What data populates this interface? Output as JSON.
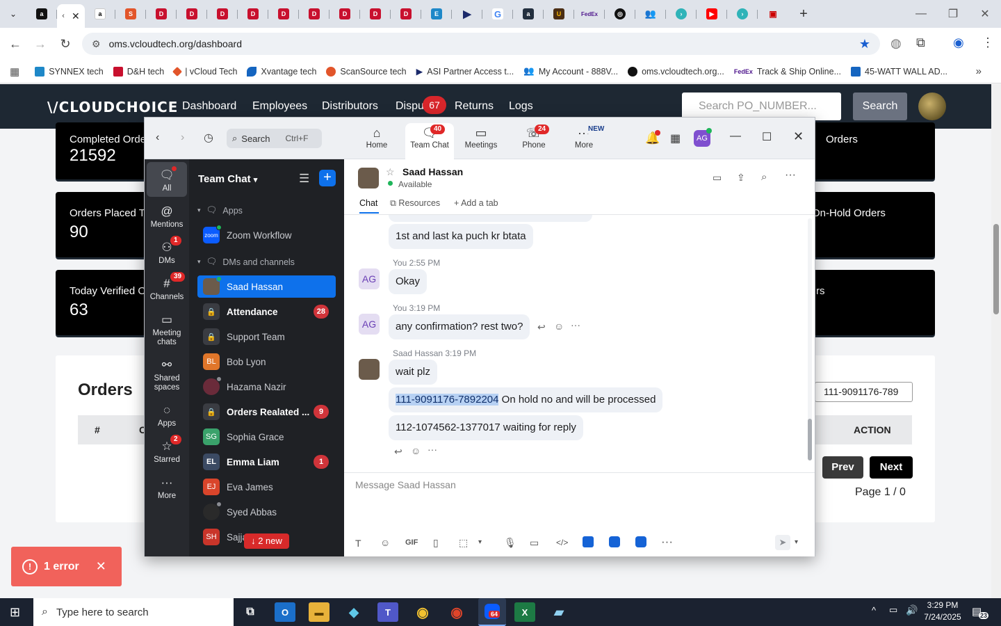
{
  "browser": {
    "url": "oms.vcloudtech.org/dashboard",
    "bookmarks": [
      "SYNNEX tech",
      "D&H tech",
      "| vCloud Tech",
      "Xvantage tech",
      "ScanSource tech",
      "ASI Partner Access t...",
      "My Account - 888V...",
      "oms.vcloudtech.org...",
      "Track & Ship Online...",
      "45-WATT WALL AD..."
    ]
  },
  "site": {
    "logo": "\\/CLOUDCHOICE",
    "nav": [
      "Dashboard",
      "Employees",
      "Distributors",
      "Dispu",
      "Returns",
      "Logs"
    ],
    "disputes_badge": "67",
    "search_placeholder": "Search PO_NUMBER...",
    "search_button": "Search",
    "cards": [
      {
        "label": "Completed Order",
        "value": "21592"
      },
      {
        "label": "Orders Placed Toc",
        "value": "90"
      },
      {
        "label": "Today Verified Or",
        "value": "63"
      }
    ],
    "right_cards": [
      "Orders",
      "On-Hold Orders",
      "rs"
    ],
    "orders_title": "Orders",
    "col_hash": "#",
    "col_c": "C",
    "col_action": "ACTION",
    "filter_value": "111-9091176-789",
    "prev": "Prev",
    "next": "Next",
    "page_info": "Page 1 / 0"
  },
  "toast": {
    "text": "1 error"
  },
  "zoom": {
    "search": "Search",
    "search_shortcut": "Ctrl+F",
    "tabs": [
      {
        "label": "Home",
        "badge": ""
      },
      {
        "label": "Team Chat",
        "badge": "40"
      },
      {
        "label": "Meetings",
        "badge": ""
      },
      {
        "label": "Phone",
        "badge": "24"
      },
      {
        "label": "More",
        "badge": "NEW"
      }
    ],
    "user_initials": "AG",
    "rail": [
      {
        "label": "All",
        "badge": ""
      },
      {
        "label": "Mentions",
        "badge": ""
      },
      {
        "label": "DMs",
        "badge": "1"
      },
      {
        "label": "Channels",
        "badge": "39"
      },
      {
        "label": "Meeting chats",
        "badge": ""
      },
      {
        "label": "Shared spaces",
        "badge": ""
      },
      {
        "label": "Apps",
        "badge": ""
      },
      {
        "label": "Starred",
        "badge": "2"
      },
      {
        "label": "More",
        "badge": ""
      }
    ],
    "list_title": "Team Chat",
    "section_apps": "Apps",
    "section_dms": "DMs and channels",
    "zoom_workflow": "Zoom Workflow",
    "channels": [
      {
        "name": "Saad Hassan",
        "count": "",
        "initials": "",
        "color": "#6b5b4b"
      },
      {
        "name": "Attendance",
        "count": "28",
        "initials": "",
        "color": "#3a3c42"
      },
      {
        "name": "Support Team",
        "count": "",
        "initials": "",
        "color": "#3a3c42"
      },
      {
        "name": "Bob Lyon",
        "count": "",
        "initials": "BL",
        "color": "#e0762a"
      },
      {
        "name": "Hazama Nazir",
        "count": "",
        "initials": "",
        "color": "#6a2b3a"
      },
      {
        "name": "Orders Realated ...",
        "count": "9",
        "initials": "",
        "color": "#3a3c42"
      },
      {
        "name": "Sophia Grace",
        "count": "",
        "initials": "SG",
        "color": "#3aa26b"
      },
      {
        "name": "Emma Liam",
        "count": "1",
        "initials": "EL",
        "color": "#3b4a63"
      },
      {
        "name": "Eva James",
        "count": "",
        "initials": "EJ",
        "color": "#d9452b"
      },
      {
        "name": "Syed Abbas",
        "count": "",
        "initials": "",
        "color": "#2a2a2a"
      },
      {
        "name": "Sajja",
        "count": "",
        "initials": "SH",
        "color": "#c9352a"
      }
    ],
    "new_pill": "↓ 2 new",
    "contact": {
      "name": "Saad Hassan",
      "status": "Available"
    },
    "chat_tabs": {
      "chat": "Chat",
      "resources": "Resources",
      "add": "Add a tab"
    },
    "messages": {
      "m1": "1st and last ka puch kr btata",
      "meta2": "You 2:55 PM",
      "m2": "Okay",
      "meta3": "You 3:19 PM",
      "m3": "any confirmation? rest two?",
      "meta4": "Saad Hassan 3:19 PM",
      "m4": "wait plz",
      "m5_hl": "111-9091176-7892204",
      "m5_rest": " On hold no and will be processed",
      "m6": "112-1074562-1377017 waiting for reply"
    },
    "composer_placeholder": "Message Saad Hassan",
    "gif": "GIF"
  },
  "taskbar": {
    "search": "Type here to search",
    "zoom_badge": "64",
    "time": "3:29 PM",
    "date": "7/24/2025",
    "notif": "23"
  }
}
